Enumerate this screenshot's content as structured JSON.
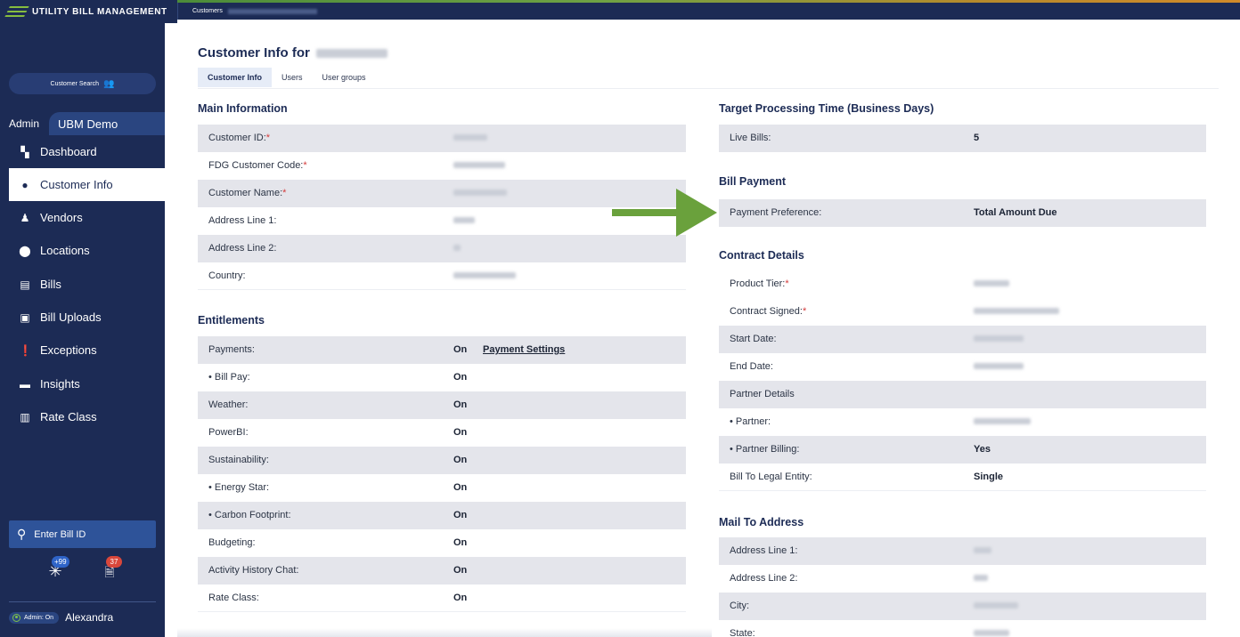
{
  "app": {
    "title": "UTILITY BILL MANAGEMENT",
    "breadcrumb": "Customers"
  },
  "sidebar": {
    "customer_search": "Customer Search",
    "admin_label": "Admin",
    "org_name": "UBM Demo",
    "nav": [
      {
        "label": "Dashboard",
        "icon": "dashboard-icon"
      },
      {
        "label": "Customer Info",
        "icon": "person-icon",
        "active": true
      },
      {
        "label": "Vendors",
        "icon": "vendor-icon"
      },
      {
        "label": "Locations",
        "icon": "map-pin-icon"
      },
      {
        "label": "Bills",
        "icon": "document-icon"
      },
      {
        "label": "Bill Uploads",
        "icon": "upload-icon"
      },
      {
        "label": "Exceptions",
        "icon": "alert-icon"
      },
      {
        "label": "Insights",
        "icon": "message-icon"
      },
      {
        "label": "Rate Class",
        "icon": "chart-icon"
      }
    ],
    "bill_id_placeholder": "Enter Bill ID",
    "badge_snowflake": "+99",
    "badge_doc": "37",
    "admin_toggle": "Admin: On",
    "user_name": "Alexandra"
  },
  "page": {
    "title_prefix": "Customer Info for",
    "tabs": [
      "Customer Info",
      "Users",
      "User groups"
    ]
  },
  "main_information": {
    "title": "Main Information",
    "rows": [
      {
        "label": "Customer ID:",
        "required": "*"
      },
      {
        "label": "FDG Customer Code:",
        "required": "*"
      },
      {
        "label": "Customer Name:",
        "required": "*"
      },
      {
        "label": "Address Line 1:"
      },
      {
        "label": "Address Line 2:"
      },
      {
        "label": "Country:"
      }
    ]
  },
  "entitlements": {
    "title": "Entitlements",
    "rows": [
      {
        "label": "Payments:",
        "value": "On",
        "link": "Payment Settings"
      },
      {
        "label": "•  Bill Pay:",
        "value": "On"
      },
      {
        "label": "Weather:",
        "value": "On"
      },
      {
        "label": "PowerBI:",
        "value": "On"
      },
      {
        "label": "Sustainability:",
        "value": "On"
      },
      {
        "label": "•  Energy Star:",
        "value": "On"
      },
      {
        "label": "•  Carbon Footprint:",
        "value": "On"
      },
      {
        "label": "Budgeting:",
        "value": "On"
      },
      {
        "label": "Activity History Chat:",
        "value": "On"
      },
      {
        "label": "Rate Class:",
        "value": "On"
      }
    ]
  },
  "target_processing": {
    "title": "Target Processing Time (Business Days)",
    "rows": [
      {
        "label": "Live Bills:",
        "value": "5"
      }
    ]
  },
  "bill_payment": {
    "title": "Bill Payment",
    "rows": [
      {
        "label": "Payment Preference:",
        "value": "Total Amount Due"
      }
    ]
  },
  "contract_details": {
    "title": "Contract Details",
    "rows": [
      {
        "label": "Product Tier:",
        "required": "*"
      },
      {
        "label": "Contract Signed:",
        "required": "*"
      },
      {
        "label": "Start Date:"
      },
      {
        "label": "End Date:"
      },
      {
        "label": "Partner Details"
      },
      {
        "label": "•  Partner:"
      },
      {
        "label": "•  Partner Billing:",
        "value": "Yes"
      },
      {
        "label": "Bill To Legal Entity:",
        "value": "Single"
      }
    ]
  },
  "mail_to_address": {
    "title": "Mail To Address",
    "rows": [
      {
        "label": "Address Line 1:"
      },
      {
        "label": "Address Line 2:"
      },
      {
        "label": "City:"
      },
      {
        "label": "State:"
      }
    ]
  },
  "colors": {
    "sidebar_bg": "#1c2b55",
    "brand_green": "#86bd3f",
    "arrow_green": "#6aa13c",
    "row_shade": "#e4e5eb",
    "link_blue": "#2c5aa6",
    "required_red": "#d43b3b",
    "badge_blue": "#2f64c8",
    "badge_red": "#d9473b"
  }
}
